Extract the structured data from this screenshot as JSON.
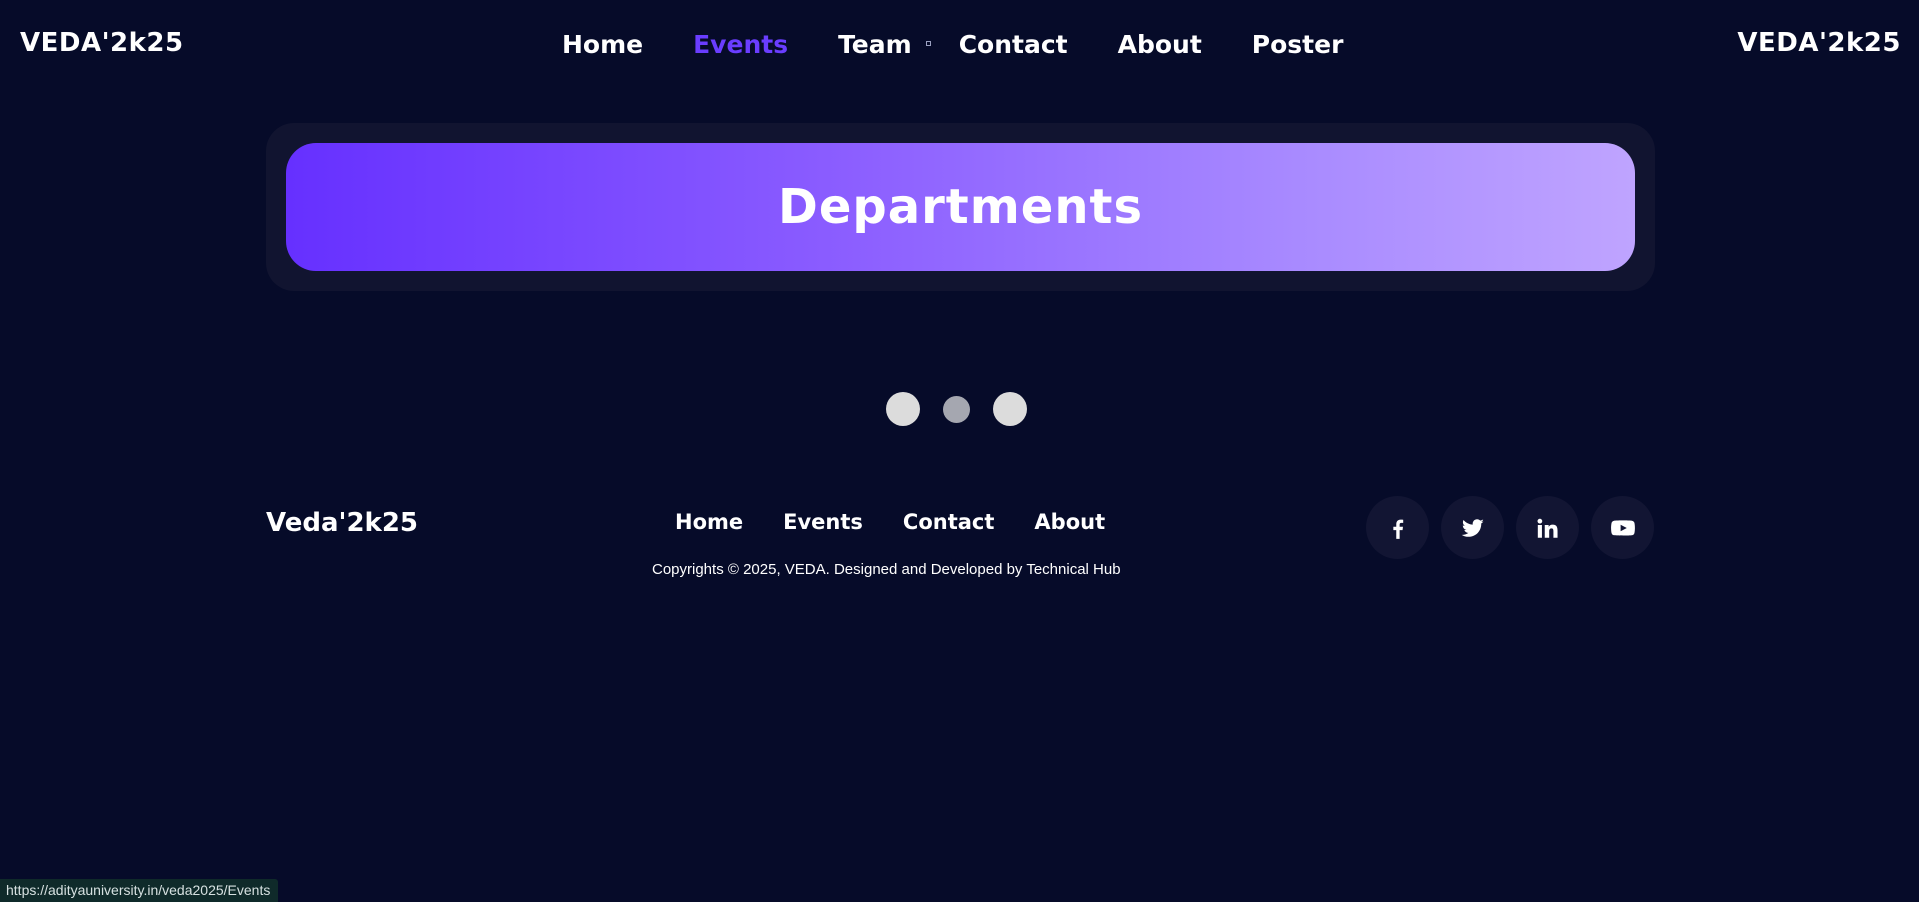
{
  "header": {
    "logo_left": "VEDA'2k25",
    "logo_right": "VEDA'2k25",
    "nav": [
      "Home",
      "Events",
      "Team",
      "Contact",
      "About",
      "Poster"
    ],
    "active_nav": "Events"
  },
  "banner": {
    "title": "Departments"
  },
  "footer": {
    "logo": "Veda'2k25",
    "nav": [
      "Home",
      "Events",
      "Contact",
      "About"
    ],
    "copyright": "Copyrights © 2025, VEDA. Designed and Developed by Technical Hub",
    "socials": [
      "facebook-icon",
      "twitter-icon",
      "linkedin-icon",
      "youtube-icon"
    ]
  },
  "status_bar": {
    "url": "https://adityauniversity.in/veda2025/Events"
  },
  "colors": {
    "background": "#060b29",
    "accent": "#6a3dff",
    "banner_gradient_start": "#6630ff",
    "banner_gradient_end": "#bfa4ff"
  }
}
